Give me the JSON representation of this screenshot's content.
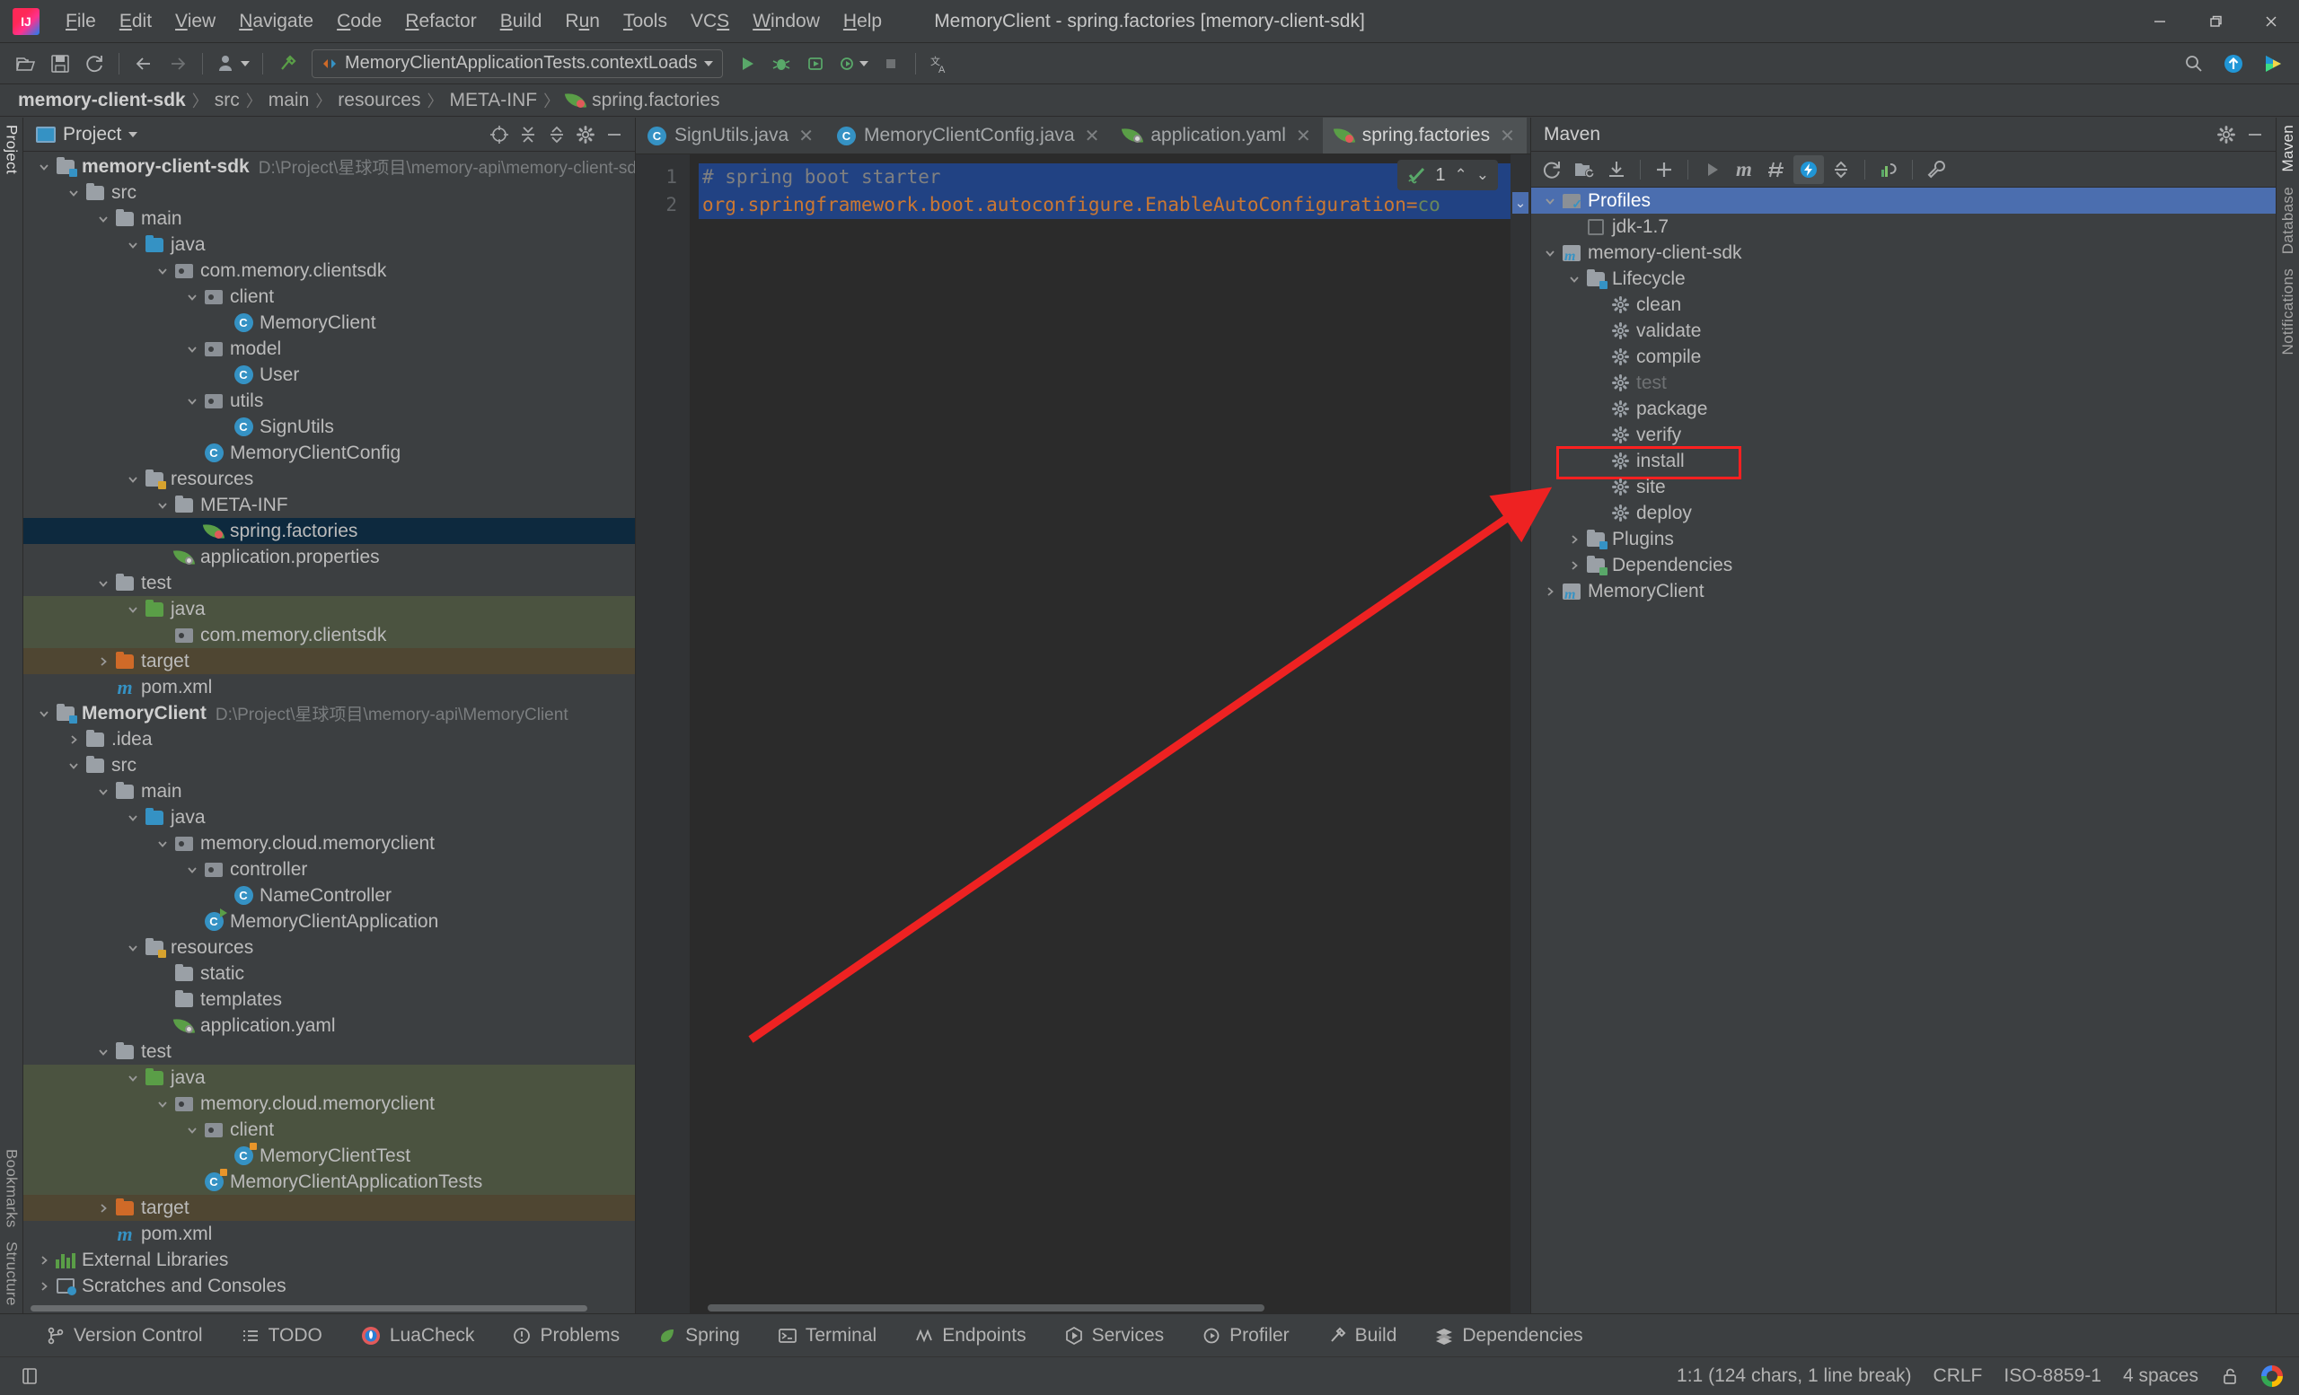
{
  "window": {
    "title": "MemoryClient - spring.factories [memory-client-sdk]",
    "minimize": "—",
    "maximize": "❐",
    "close": "✕"
  },
  "menu": [
    {
      "label": "File",
      "mnemonic": "F"
    },
    {
      "label": "Edit",
      "mnemonic": "E"
    },
    {
      "label": "View",
      "mnemonic": "V"
    },
    {
      "label": "Navigate",
      "mnemonic": "N"
    },
    {
      "label": "Code",
      "mnemonic": "C"
    },
    {
      "label": "Refactor",
      "mnemonic": "R"
    },
    {
      "label": "Build",
      "mnemonic": "B"
    },
    {
      "label": "Run",
      "mnemonic": "u"
    },
    {
      "label": "Tools",
      "mnemonic": "T"
    },
    {
      "label": "VCS",
      "mnemonic": "S"
    },
    {
      "label": "Window",
      "mnemonic": "W"
    },
    {
      "label": "Help",
      "mnemonic": "H"
    }
  ],
  "toolbar": {
    "open_icon": "open-folder-icon",
    "save_icon": "save-icon",
    "sync_icon": "sync-icon",
    "back_icon": "back-arrow-icon",
    "forward_icon": "forward-arrow-icon",
    "profile_icon": "user-profile-icon",
    "build_icon": "build-hammer-icon",
    "run_config": "MemoryClientApplicationTests.contextLoads",
    "run_icon": "run-icon",
    "debug_icon": "debug-icon",
    "coverage_icon": "coverage-icon",
    "profiler_icon": "profiler-icon",
    "stop_icon": "stop-icon",
    "translate_icon": "translate-icon",
    "search_icon": "search-icon",
    "update_icon": "update-icon",
    "ide_icon": "ide-feature-icon"
  },
  "breadcrumb": [
    "memory-client-sdk",
    "src",
    "main",
    "resources",
    "META-INF",
    "spring.factories"
  ],
  "left_strip": [
    "Project"
  ],
  "right_strip": [
    "Maven",
    "Database",
    "Notifications"
  ],
  "bottom_left_strip": [
    "Bookmarks",
    "Structure"
  ],
  "project_panel": {
    "title": "Project",
    "head_icons": [
      "target-icon",
      "expand-all-icon",
      "collapse-all-icon",
      "settings-gear-icon",
      "hide-icon"
    ],
    "tree": [
      {
        "depth": 0,
        "twist": "down",
        "icon": "module-folder-icon",
        "label": "memory-client-sdk",
        "bold": true,
        "path": "D:\\Project\\星球项目\\memory-api\\memory-client-sdk"
      },
      {
        "depth": 1,
        "twist": "down",
        "icon": "folder-icon",
        "label": "src"
      },
      {
        "depth": 2,
        "twist": "down",
        "icon": "folder-icon",
        "label": "main"
      },
      {
        "depth": 3,
        "twist": "down",
        "icon": "source-folder-icon",
        "label": "java"
      },
      {
        "depth": 4,
        "twist": "down",
        "icon": "package-icon",
        "label": "com.memory.clientsdk"
      },
      {
        "depth": 5,
        "twist": "down",
        "icon": "package-icon",
        "label": "client"
      },
      {
        "depth": 6,
        "twist": "none",
        "icon": "java-class-icon",
        "label": "MemoryClient"
      },
      {
        "depth": 5,
        "twist": "down",
        "icon": "package-icon",
        "label": "model"
      },
      {
        "depth": 6,
        "twist": "none",
        "icon": "java-class-icon",
        "label": "User"
      },
      {
        "depth": 5,
        "twist": "down",
        "icon": "package-icon",
        "label": "utils"
      },
      {
        "depth": 6,
        "twist": "none",
        "icon": "java-class-icon",
        "label": "SignUtils"
      },
      {
        "depth": 5,
        "twist": "none",
        "icon": "java-class-icon",
        "label": "MemoryClientConfig"
      },
      {
        "depth": 3,
        "twist": "down",
        "icon": "resources-folder-icon",
        "label": "resources"
      },
      {
        "depth": 4,
        "twist": "down",
        "icon": "folder-icon",
        "label": "META-INF"
      },
      {
        "depth": 5,
        "twist": "none",
        "icon": "spring-factories-icon",
        "label": "spring.factories",
        "selected": true
      },
      {
        "depth": 4,
        "twist": "none",
        "icon": "spring-config-icon",
        "label": "application.properties"
      },
      {
        "depth": 2,
        "twist": "down",
        "icon": "folder-icon",
        "label": "test"
      },
      {
        "depth": 3,
        "twist": "down",
        "icon": "test-source-folder-icon",
        "label": "java",
        "testsrc": true
      },
      {
        "depth": 4,
        "twist": "none",
        "icon": "package-icon",
        "label": "com.memory.clientsdk",
        "testsrc": true
      },
      {
        "depth": 2,
        "twist": "right",
        "icon": "target-folder-icon",
        "label": "target",
        "targetdir": true
      },
      {
        "depth": 2,
        "twist": "none",
        "icon": "maven-pom-icon",
        "label": "pom.xml"
      },
      {
        "depth": 0,
        "twist": "down",
        "icon": "module-folder-icon",
        "label": "MemoryClient",
        "bold": true,
        "path": "D:\\Project\\星球项目\\memory-api\\MemoryClient"
      },
      {
        "depth": 1,
        "twist": "right",
        "icon": "folder-icon",
        "label": ".idea"
      },
      {
        "depth": 1,
        "twist": "down",
        "icon": "folder-icon",
        "label": "src"
      },
      {
        "depth": 2,
        "twist": "down",
        "icon": "folder-icon",
        "label": "main"
      },
      {
        "depth": 3,
        "twist": "down",
        "icon": "source-folder-icon",
        "label": "java"
      },
      {
        "depth": 4,
        "twist": "down",
        "icon": "package-icon",
        "label": "memory.cloud.memoryclient"
      },
      {
        "depth": 5,
        "twist": "down",
        "icon": "package-icon",
        "label": "controller"
      },
      {
        "depth": 6,
        "twist": "none",
        "icon": "java-class-icon",
        "label": "NameController"
      },
      {
        "depth": 5,
        "twist": "none",
        "icon": "spring-boot-app-icon",
        "label": "MemoryClientApplication"
      },
      {
        "depth": 3,
        "twist": "down",
        "icon": "resources-folder-icon",
        "label": "resources"
      },
      {
        "depth": 4,
        "twist": "none",
        "icon": "folder-icon",
        "label": "static"
      },
      {
        "depth": 4,
        "twist": "none",
        "icon": "folder-icon",
        "label": "templates"
      },
      {
        "depth": 4,
        "twist": "none",
        "icon": "spring-config-icon",
        "label": "application.yaml"
      },
      {
        "depth": 2,
        "twist": "down",
        "icon": "folder-icon",
        "label": "test"
      },
      {
        "depth": 3,
        "twist": "down",
        "icon": "test-source-folder-icon",
        "label": "java",
        "testsrc": true
      },
      {
        "depth": 4,
        "twist": "down",
        "icon": "package-icon",
        "label": "memory.cloud.memoryclient",
        "testsrc": true
      },
      {
        "depth": 5,
        "twist": "down",
        "icon": "package-icon",
        "label": "client",
        "testsrc": true
      },
      {
        "depth": 6,
        "twist": "none",
        "icon": "java-test-class-icon",
        "label": "MemoryClientTest",
        "testsrc": true
      },
      {
        "depth": 5,
        "twist": "none",
        "icon": "java-test-class-icon",
        "label": "MemoryClientApplicationTests",
        "testsrc": true
      },
      {
        "depth": 2,
        "twist": "right",
        "icon": "target-folder-icon",
        "label": "target",
        "targetdir": true
      },
      {
        "depth": 2,
        "twist": "none",
        "icon": "maven-pom-icon",
        "label": "pom.xml"
      },
      {
        "depth": 0,
        "twist": "right",
        "icon": "external-libraries-icon",
        "label": "External Libraries"
      },
      {
        "depth": 0,
        "twist": "right",
        "icon": "scratches-icon",
        "label": "Scratches and Consoles"
      }
    ]
  },
  "editor": {
    "tabs": [
      {
        "label": "SignUtils.java",
        "icon": "java-class-icon",
        "active": false,
        "closable": true
      },
      {
        "label": "MemoryClientConfig.java",
        "icon": "java-class-icon",
        "active": false,
        "closable": true
      },
      {
        "label": "application.yaml",
        "icon": "spring-config-icon",
        "active": false,
        "closable": true
      },
      {
        "label": "spring.factories",
        "icon": "spring-factories-icon",
        "active": true,
        "closable": true
      }
    ],
    "tab_actions": [
      "chevron-down-icon",
      "more-options-icon"
    ],
    "line_numbers": [
      "1",
      "2"
    ],
    "lines": [
      {
        "n": 1,
        "comment": "# spring boot starter"
      },
      {
        "n": 2,
        "key": "org.springframework.boot.autoconfigure.EnableAutoConfiguration",
        "eq": "=",
        "value": "co"
      }
    ],
    "inspection": {
      "count": "1",
      "icon": "inspection-ok-icon",
      "up": "⌃",
      "down": "⌄"
    }
  },
  "maven_panel": {
    "title": "Maven",
    "header_icons": [
      "settings-gear-icon",
      "hide-icon"
    ],
    "toolbar_icons": [
      "reload-all-icon",
      "add-maven-project-icon",
      "download-sources-icon",
      "add-icon",
      "run-icon",
      "execute-maven-goal-icon",
      "toggle-skip-tests-icon",
      "toggle-offline-icon",
      "collapse-all-icon",
      "show-dependencies-icon",
      "maven-settings-icon"
    ],
    "tree": [
      {
        "depth": 0,
        "twist": "down",
        "icon": "profiles-icon",
        "label": "Profiles",
        "selected": true
      },
      {
        "depth": 1,
        "twist": "none",
        "icon": "checkbox-icon",
        "label": "jdk-1.7"
      },
      {
        "depth": 0,
        "twist": "down",
        "icon": "maven-module-icon",
        "label": "memory-client-sdk"
      },
      {
        "depth": 1,
        "twist": "down",
        "icon": "lifecycle-folder-icon",
        "label": "Lifecycle"
      },
      {
        "depth": 2,
        "twist": "none",
        "icon": "gear-icon",
        "label": "clean"
      },
      {
        "depth": 2,
        "twist": "none",
        "icon": "gear-icon",
        "label": "validate"
      },
      {
        "depth": 2,
        "twist": "none",
        "icon": "gear-icon",
        "label": "compile"
      },
      {
        "depth": 2,
        "twist": "none",
        "icon": "gear-icon",
        "label": "test",
        "dim": true
      },
      {
        "depth": 2,
        "twist": "none",
        "icon": "gear-icon",
        "label": "package"
      },
      {
        "depth": 2,
        "twist": "none",
        "icon": "gear-icon",
        "label": "verify"
      },
      {
        "depth": 2,
        "twist": "none",
        "icon": "gear-icon",
        "label": "install",
        "highlighted": true
      },
      {
        "depth": 2,
        "twist": "none",
        "icon": "gear-icon",
        "label": "site"
      },
      {
        "depth": 2,
        "twist": "none",
        "icon": "gear-icon",
        "label": "deploy"
      },
      {
        "depth": 1,
        "twist": "right",
        "icon": "plugins-folder-icon",
        "label": "Plugins"
      },
      {
        "depth": 1,
        "twist": "right",
        "icon": "dependencies-folder-icon",
        "label": "Dependencies"
      },
      {
        "depth": 0,
        "twist": "right",
        "icon": "maven-module-icon",
        "label": "MemoryClient"
      }
    ]
  },
  "annotation": {
    "highlight_color": "#ff2020",
    "arrow_color": "#ee2222",
    "target": "install"
  },
  "toolwindow_bar": [
    {
      "label": "Version Control",
      "icon": "branch-icon"
    },
    {
      "label": "TODO",
      "icon": "todo-list-icon"
    },
    {
      "label": "LuaCheck",
      "icon": "luacheck-icon"
    },
    {
      "label": "Problems",
      "icon": "problems-icon"
    },
    {
      "label": "Spring",
      "icon": "spring-leaf-icon"
    },
    {
      "label": "Terminal",
      "icon": "terminal-icon"
    },
    {
      "label": "Endpoints",
      "icon": "endpoints-icon"
    },
    {
      "label": "Services",
      "icon": "services-icon"
    },
    {
      "label": "Profiler",
      "icon": "profiler-icon"
    },
    {
      "label": "Build",
      "icon": "build-hammer-icon"
    },
    {
      "label": "Dependencies",
      "icon": "dependencies-icon"
    }
  ],
  "statusbar": {
    "left_icon": "toggle-toolwindows-icon",
    "caret": "1:1 (124 chars, 1 line break)",
    "line_separator": "CRLF",
    "encoding": "ISO-8859-1",
    "indent": "4 spaces",
    "lock_icon": "unlocked-icon",
    "account_icon": "google-account-icon"
  }
}
